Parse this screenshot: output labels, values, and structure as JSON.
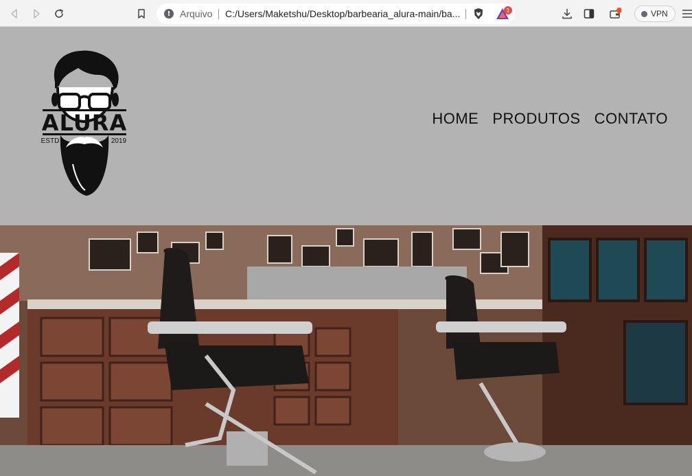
{
  "browser": {
    "address_scheme_label": "Arquivo",
    "url": "C:/Users/Maketshu/Desktop/barbearia_alura-main/ba...",
    "rewards_badge": "1",
    "vpn_label": "VPN"
  },
  "site": {
    "logo": {
      "brand": "ALURA",
      "estd_label": "ESTD",
      "year": "2019"
    },
    "nav": [
      {
        "label": "HOME"
      },
      {
        "label": "PRODUTOS"
      },
      {
        "label": "CONTATO"
      }
    ]
  },
  "icons": {
    "back": "arrow-left-icon",
    "forward": "arrow-right-icon",
    "reload": "reload-icon",
    "bookmark": "bookmark-icon",
    "info": "info-icon",
    "brave": "brave-shield-icon",
    "rewards": "brave-rewards-icon",
    "downloads": "download-icon",
    "sidebar": "sidebar-icon",
    "wallet": "wallet-icon",
    "menu": "hamburger-menu-icon"
  },
  "colors": {
    "header_bg": "#b3b3b3",
    "nav_text": "#111111",
    "rewards_accent": "#e74c3c"
  }
}
